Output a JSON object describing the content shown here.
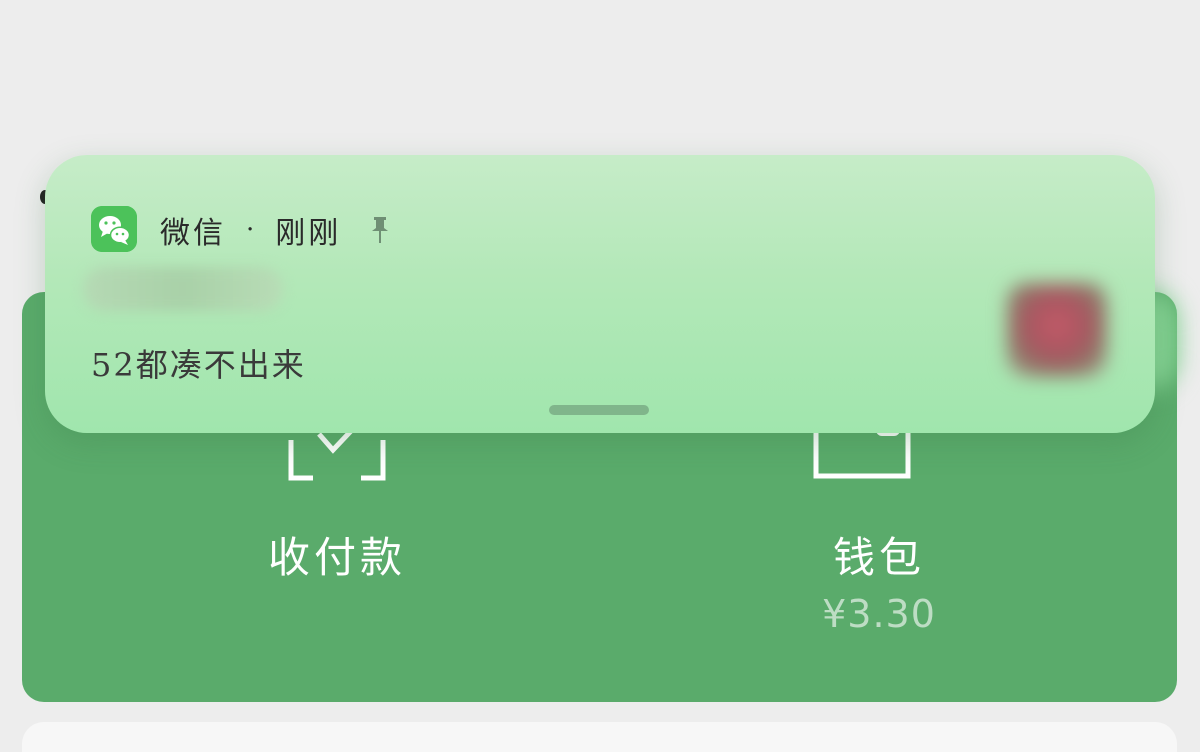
{
  "notification": {
    "app_name": "微信",
    "separator": "·",
    "time": "刚刚",
    "message": "52都凑不出来"
  },
  "pay_card": {
    "pay_label": "收付款",
    "wallet_label": "钱包",
    "wallet_balance": "¥3.30"
  },
  "icons": {
    "app": "wechat-icon",
    "pin": "pin-icon",
    "pay": "scan-check-icon",
    "wallet": "wallet-icon"
  },
  "colors": {
    "card_green": "#5aab6b",
    "banner_green": "#b3e8b8",
    "wechat_green": "#4cc25a",
    "background": "#ededed"
  }
}
